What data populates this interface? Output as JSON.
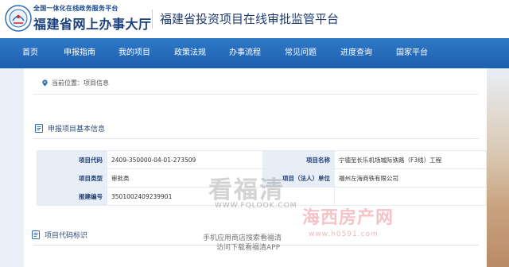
{
  "header": {
    "logo_top": "全国一体化在线政务服务平台",
    "logo_main": "福建省网上办事大厅",
    "title": "福建省投资项目在线审批监管平台"
  },
  "nav": {
    "items": [
      "首页",
      "申报指南",
      "我的项目",
      "政策法规",
      "办事流程",
      "常见问题",
      "进度查询",
      "国家平台"
    ]
  },
  "breadcrumb": {
    "label": "当前位置：",
    "current": "项目信息"
  },
  "section_basic": {
    "title": "申报项目基本信息"
  },
  "info": {
    "project_code_label": "项目代码",
    "project_code": "2409-350000-04-01-273509",
    "project_name_label": "项目名称",
    "project_name": "宁德至长乐机场城际铁路（F3线）工程",
    "project_type_label": "项目类型",
    "project_type": "审批类",
    "legal_unit_label": "项目（法人）单位",
    "legal_unit": "福州左海商铁有限公司",
    "report_no_label": "报建编号",
    "report_no": "3501002409239901"
  },
  "section_code": {
    "title": "项目代码标识"
  },
  "watermarks": {
    "big": "看福清",
    "url": "WWW.FQLOOK.COM",
    "line1": "手机应用商店搜索看福清",
    "line2": "访问下载看福清APP",
    "hx": "海西房产网",
    "hx_url": "www.h0591.com"
  },
  "colors": {
    "nav": "#1c5fae",
    "label_bg": "#e8eef7",
    "title_text": "#1f3c6e"
  }
}
